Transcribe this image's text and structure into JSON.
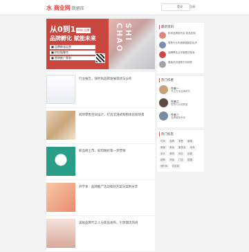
{
  "header": {
    "logo_mark": "水 商业网",
    "logo_sub": "数据库",
    "search_placeholder": "",
    "nav": [
      "登录",
      "注册"
    ]
  },
  "banner": {
    "title": "从0到1",
    "subtitle": "品牌孵化 赋能未来",
    "tag": "时尚 品牌",
    "watermark": "SHI CHAO",
    "list": [
      "■ 品牌孵化运营",
      "■ 供应链整合",
      "■ 营销推广策划"
    ]
  },
  "feed": [
    {
      "title": "行业报告，快时尚品牌发展现状与分析",
      "meta": "",
      "tag": ""
    },
    {
      "title": "商场零售空间设计，打造沉浸式购物体验新场景",
      "meta": "",
      "tag": ""
    },
    {
      "title": "新品牌上市，如何做好第一步营销",
      "meta": "",
      "tag": ""
    },
    {
      "title": "开学季 · 品牌推广活动策划方案与案例分享",
      "meta": "",
      "tag": ""
    },
    {
      "title": "美妆品牌代言人与新品发布，引领潮流风尚",
      "meta": "",
      "tag": ""
    }
  ],
  "sidebar": {
    "news_title": "最新资讯",
    "news": [
      "时尚品牌发布会 新品亮相",
      "零售行业年度数据报告出炉",
      "品牌联名合作新模式探索",
      "服装供应链数字化转型"
    ],
    "authors_title": "热门作者",
    "authors": [
      {
        "name": "作者一",
        "desc": "专注时尚品牌研究"
      },
      {
        "name": "作者二",
        "desc": "零售行业观察者"
      },
      {
        "name": "作者三",
        "desc": "品牌营销专家"
      }
    ],
    "tags_title": "热门标签",
    "tags": [
      "时尚",
      "品牌",
      "零售",
      "营销",
      "服装",
      "美妆",
      "奢侈品",
      "电商",
      "设计",
      "潮流",
      "商业",
      "运营",
      "趋势",
      "消费",
      "门店",
      "数据",
      "快时尚",
      "供应链"
    ]
  }
}
